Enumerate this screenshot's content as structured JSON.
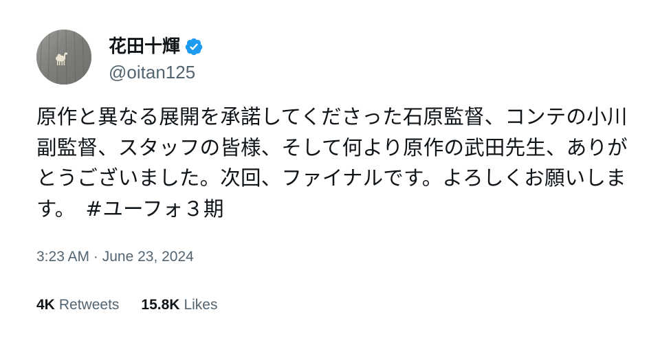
{
  "author": {
    "display_name": "花田十輝",
    "handle": "@oitan125",
    "verified": true,
    "avatar_icon": "camel-on-wood-avatar",
    "verified_color": "#1d9bf0"
  },
  "tweet": {
    "text": "原作と異なる展開を承諾してくださった石原監督、コンテの小川副監督、スタッフの皆様、そして何より原作の武田先生、ありがとうございました。次回、ファイナルです。よろしくお願いします。　",
    "hashtag": "#ユーフォ３期"
  },
  "timestamp": "3:23 AM · June 23, 2024",
  "stats": {
    "retweets_count": "4K",
    "retweets_label": "Retweets",
    "likes_count": "15.8K",
    "likes_label": "Likes"
  },
  "colors": {
    "text_primary": "#0f1419",
    "text_secondary": "#536471",
    "background": "#ffffff"
  }
}
